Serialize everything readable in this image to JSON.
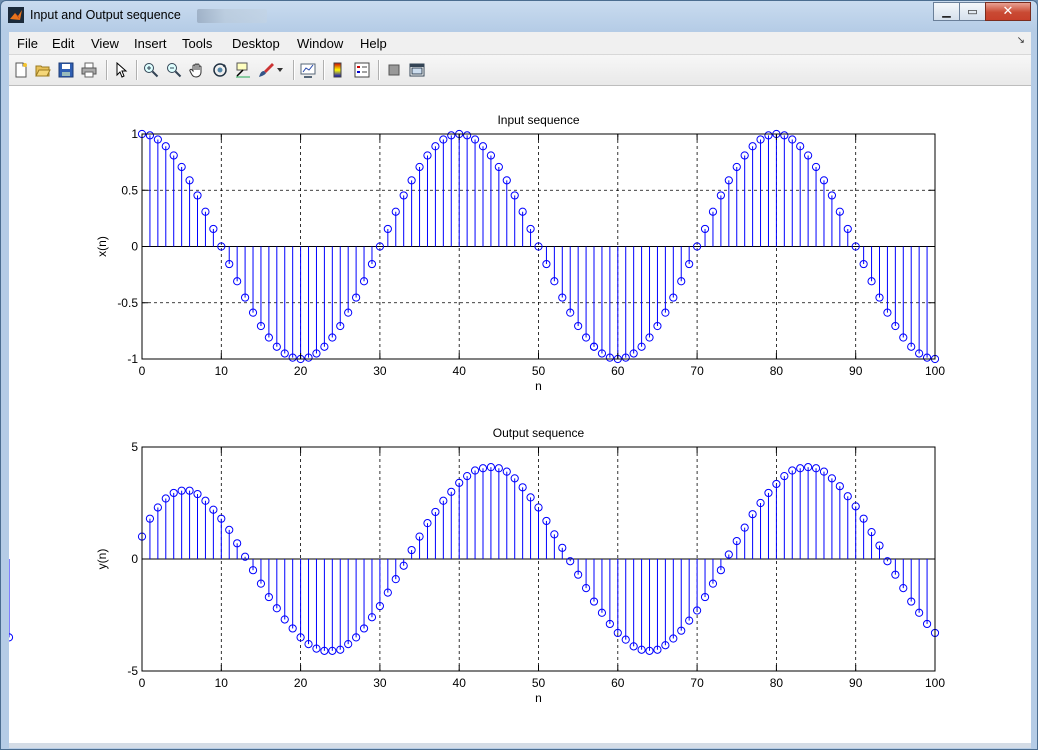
{
  "window": {
    "title": "Input and Output sequence",
    "min_glyph": "▁",
    "max_glyph": "▭",
    "close_glyph": "✕"
  },
  "menu": {
    "items": [
      "File",
      "Edit",
      "View",
      "Insert",
      "Tools",
      "Desktop",
      "Window",
      "Help"
    ],
    "overflow_glyph": "↘"
  },
  "toolbar": {
    "icons": [
      "new-figure-icon",
      "open-file-icon",
      "save-icon",
      "print-icon",
      "pointer-icon",
      "zoom-in-icon",
      "zoom-out-icon",
      "pan-hand-icon",
      "rotate-3d-icon",
      "data-cursor-icon",
      "brush-icon",
      "link-plot-icon",
      "colorbar-icon",
      "legend-icon",
      "hide-plot-tools-icon",
      "show-plot-tools-icon"
    ]
  },
  "chart_data": [
    {
      "type": "stem",
      "title": "Input sequence",
      "xlabel": "n",
      "ylabel": "x(n)",
      "xlim": [
        0,
        100
      ],
      "ylim": [
        -1,
        1
      ],
      "xticks": [
        "0",
        "10",
        "20",
        "30",
        "40",
        "50",
        "60",
        "70",
        "80",
        "90",
        "100"
      ],
      "yticks": [
        "-1",
        "-0.5",
        "0",
        "0.5",
        "1"
      ],
      "grid": true,
      "x": [
        0,
        1,
        2,
        3,
        4,
        5,
        6,
        7,
        8,
        9,
        10,
        11,
        12,
        13,
        14,
        15,
        16,
        17,
        18,
        19,
        20,
        21,
        22,
        23,
        24,
        25,
        26,
        27,
        28,
        29,
        30,
        31,
        32,
        33,
        34,
        35,
        36,
        37,
        38,
        39,
        40,
        41,
        42,
        43,
        44,
        45,
        46,
        47,
        48,
        49,
        50,
        51,
        52,
        53,
        54,
        55,
        56,
        57,
        57,
        58,
        59,
        60,
        61,
        62,
        63,
        64,
        65,
        66,
        67,
        68,
        69,
        70,
        71,
        72,
        73,
        74,
        75,
        76,
        77,
        78,
        79,
        80,
        81,
        82,
        83,
        84,
        85,
        86,
        87,
        88,
        89,
        90,
        91,
        92,
        93,
        94,
        95,
        96,
        97,
        98,
        99,
        100
      ],
      "values": [
        1,
        0.988,
        0.951,
        0.891,
        0.809,
        0.707,
        0.588,
        0.454,
        0.309,
        0.156,
        0,
        -0.156,
        -0.309,
        -0.454,
        -0.588,
        -0.707,
        -0.809,
        -0.891,
        -0.951,
        -0.988,
        -1,
        -0.988,
        -0.951,
        -0.891,
        -0.809,
        -0.707,
        -0.588,
        -0.454,
        -0.309,
        -0.156,
        0,
        0.156,
        0.309,
        0.454,
        0.588,
        0.707,
        0.809,
        0.891,
        0.951,
        0.988,
        1,
        0.988,
        0.951,
        0.891,
        0.809,
        0.707,
        0.588,
        0.454,
        0.309,
        0.156,
        0,
        -0.156,
        -0.309,
        -0.454,
        -0.588,
        -0.707,
        -0.809,
        -0.891,
        -0.891,
        -0.951,
        -0.988,
        -1,
        -0.988,
        -0.951,
        -0.891,
        -0.809,
        -0.707,
        -0.588,
        -0.454,
        -0.309,
        -0.156,
        0,
        0.156,
        0.309,
        0.454,
        0.588,
        0.707,
        0.809,
        0.891,
        0.951,
        0.988,
        1,
        0.988,
        0.951,
        0.891,
        0.809,
        0.707,
        0.588,
        0.454,
        0.309,
        0.156,
        0,
        -0.156,
        -0.309,
        -0.454,
        -0.588,
        -0.707,
        -0.809,
        -0.891,
        -0.951,
        -0.988,
        -1
      ],
      "marker_color": "#0000ff"
    },
    {
      "type": "stem",
      "title": "Output sequence",
      "xlabel": "n",
      "ylabel": "y(n)",
      "xlim": [
        0,
        100
      ],
      "ylim": [
        -5,
        5
      ],
      "xticks": [
        "0",
        "10",
        "20",
        "30",
        "40",
        "50",
        "60",
        "70",
        "80",
        "90",
        "100"
      ],
      "yticks": [
        "-5",
        "0",
        "5"
      ],
      "grid": true,
      "x": [
        0,
        1,
        2,
        3,
        4,
        5,
        6,
        7,
        8,
        9,
        10,
        11,
        12,
        13,
        14,
        15,
        16,
        17,
        18,
        19,
        20,
        21,
        22,
        23,
        24,
        25,
        26,
        27,
        28,
        29,
        30,
        31,
        32,
        33,
        34,
        35,
        36,
        37,
        38,
        39,
        40,
        41,
        42,
        43,
        44,
        45,
        46,
        47,
        48,
        49,
        50,
        51,
        52,
        53,
        54,
        55,
        56,
        57,
        58,
        59,
        60,
        61,
        62,
        63,
        64,
        65,
        66,
        67,
        68,
        69,
        70,
        71,
        72,
        73,
        74,
        75,
        76,
        77,
        78,
        79,
        80,
        81,
        82,
        83,
        84,
        85,
        86,
        87,
        88,
        89,
        90,
        91,
        92,
        93,
        94,
        95,
        96,
        97,
        98,
        99,
        100
      ],
      "values": [
        1,
        1.8,
        2.3,
        2.7,
        2.95,
        3.05,
        3.05,
        2.9,
        2.6,
        2.2,
        1.8,
        1.3,
        0.7,
        0.1,
        -0.5,
        -1.1,
        -1.7,
        -2.2,
        -2.7,
        -3.1,
        -3.5,
        -3.8,
        -4.0,
        -4.1,
        -4.1,
        -4.05,
        -3.8,
        -3.5,
        -3.1,
        -2.6,
        -2.1,
        -1.5,
        -0.9,
        -0.3,
        0.4,
        1.0,
        1.6,
        2.1,
        2.6,
        3.0,
        3.4,
        3.7,
        3.95,
        4.05,
        4.1,
        4.05,
        3.9,
        3.6,
        3.2,
        2.75,
        2.3,
        1.7,
        1.1,
        0.5,
        -0.1,
        -0.7,
        -1.3,
        -1.9,
        -2.4,
        -2.9,
        -3.3,
        -3.6,
        -3.9,
        -4.05,
        -4.1,
        -4.05,
        -3.85,
        -3.55,
        -3.2,
        -2.75,
        -2.3,
        -1.7,
        -1.1,
        -0.5,
        0.2,
        0.8,
        1.4,
        2.0,
        2.5,
        2.95,
        3.35,
        3.7,
        3.95,
        4.05,
        4.1,
        4.05,
        3.9,
        3.6,
        3.25,
        2.8,
        2.35,
        1.8,
        1.2,
        0.6,
        -0.1,
        -0.7,
        -1.3,
        -1.9,
        -2.4,
        -2.9,
        -3.3,
        -3.5
      ],
      "marker_color": "#0000ff"
    }
  ]
}
